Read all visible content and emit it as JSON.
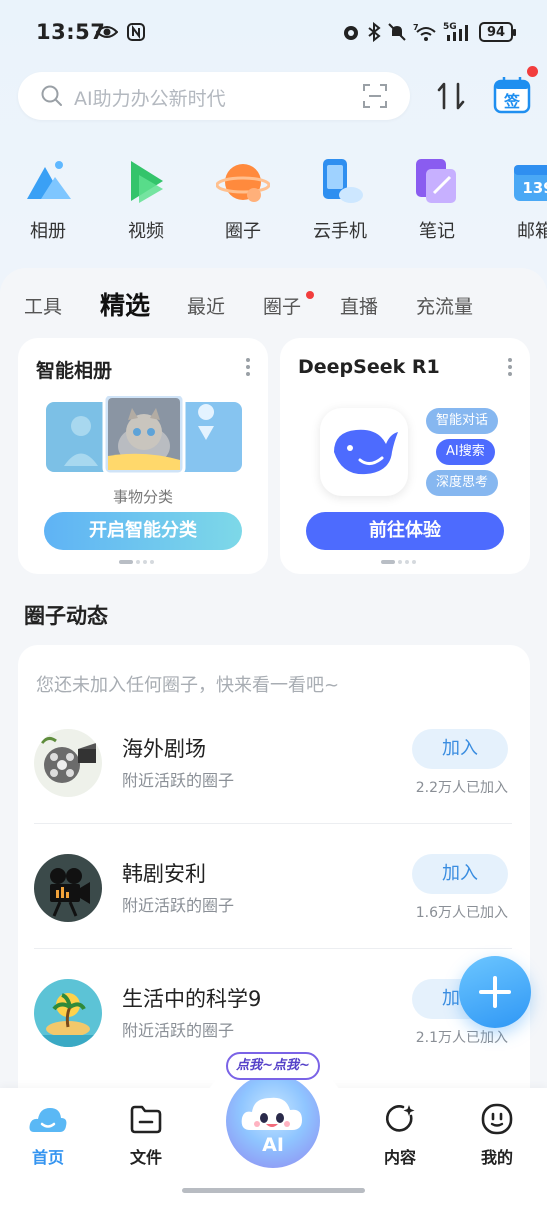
{
  "status_bar": {
    "time": "13:57",
    "battery": "94",
    "network": "5G",
    "wifi_level": "7",
    "icons": [
      "eye-icon",
      "nfc-icon",
      "alarm-icon",
      "bluetooth-icon",
      "mute-icon",
      "wifi-icon",
      "signal-icon",
      "battery-icon"
    ]
  },
  "search": {
    "placeholder": "AI助力办公新时代",
    "icons": [
      "search-icon",
      "scan-icon"
    ]
  },
  "header_actions": {
    "sign_label": "签",
    "sort_icon": "sort-icon",
    "has_notification": true
  },
  "shortcuts": [
    {
      "label": "相册",
      "icon": "album-icon"
    },
    {
      "label": "视频",
      "icon": "video-icon"
    },
    {
      "label": "圈子",
      "icon": "circle-icon"
    },
    {
      "label": "云手机",
      "icon": "cloud-phone-icon"
    },
    {
      "label": "笔记",
      "icon": "note-icon"
    },
    {
      "label": "邮箱",
      "icon": "mail-icon",
      "badge": "139"
    }
  ],
  "tabs": [
    {
      "label": "工具"
    },
    {
      "label": "精选",
      "active": true
    },
    {
      "label": "最近"
    },
    {
      "label": "圈子",
      "dot": true
    },
    {
      "label": "直播"
    },
    {
      "label": "充流量"
    }
  ],
  "cards": [
    {
      "title": "智能相册",
      "subtitle": "事物分类",
      "button": "开启智能分类"
    },
    {
      "title": "DeepSeek R1",
      "tags": [
        "智能对话",
        "AI搜索",
        "深度思考"
      ],
      "button": "前往体验"
    }
  ],
  "circles": {
    "section_title": "圈子动态",
    "hint": "您还未加入任何圈子，快来看一看吧~",
    "join_label": "加入",
    "items": [
      {
        "name": "海外剧场",
        "desc": "附近活跃的圈子",
        "count": "2.2万人已加入",
        "icon": "film-reel-icon"
      },
      {
        "name": "韩剧安利",
        "desc": "附近活跃的圈子",
        "count": "1.6万人已加入",
        "icon": "movie-camera-icon"
      },
      {
        "name": "生活中的科学9",
        "desc": "附近活跃的圈子",
        "count": "2.1万人已加入",
        "icon": "island-icon"
      }
    ]
  },
  "bottom_nav": {
    "items": [
      {
        "label": "首页",
        "icon": "home-cloud-icon",
        "active": true
      },
      {
        "label": "文件",
        "icon": "folder-icon"
      },
      {
        "label": "内容",
        "icon": "content-icon"
      },
      {
        "label": "我的",
        "icon": "profile-icon"
      }
    ],
    "ai_bubble": "点我~点我~",
    "ai_label": "AI"
  },
  "colors": {
    "accent": "#3494f0",
    "join_bg": "#e5f1fc",
    "deepseek_blue": "#4d6bfe",
    "badge_red": "#f23d3d"
  }
}
